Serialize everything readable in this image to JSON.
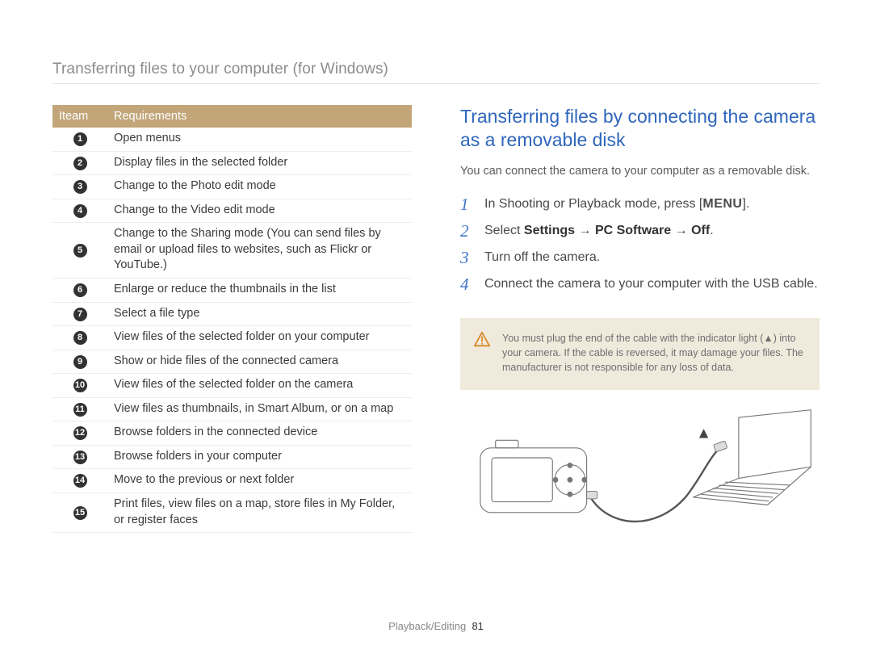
{
  "pageHeader": "Transferring files to your computer (for Windows)",
  "table": {
    "head": [
      "Iteam",
      "Requirements"
    ],
    "rows": [
      "Open menus",
      "Display files in the selected folder",
      "Change to the Photo edit mode",
      "Change to the Video edit mode",
      "Change to the Sharing mode (You can send files by email or upload files to websites, such as Flickr or YouTube.)",
      "Enlarge or reduce the thumbnails in the list",
      "Select a file type",
      "View files of the selected folder on your computer",
      "Show or hide files of the connected camera",
      "View files of the selected folder on the camera",
      "View files as thumbnails, in Smart Album, or on a map",
      "Browse folders in the connected device",
      "Browse folders in your computer",
      "Move to the previous or next folder",
      "Print files, view files on a map, store files in My Folder, or register faces"
    ]
  },
  "right": {
    "title": "Transferring files by connecting the camera as a removable disk",
    "intro": "You can connect the camera to your computer as a removable disk.",
    "steps": {
      "s1_pre": "In Shooting or Playback mode, press [",
      "s1_key": "MENU",
      "s1_post": "].",
      "s2_pre": "Select ",
      "s2_strong1": "Settings",
      "s2_arrow": " → ",
      "s2_strong2": "PC Software",
      "s2_strong3": "Off",
      "s2_post": ".",
      "s3": "Turn off the camera.",
      "s4": "Connect the camera to your computer with the USB cable."
    },
    "notice": "You must plug the end of the cable with the indicator light (▲) into your camera. If the cable is reversed, it may damage your files. The manufacturer is not responsible for any loss of data."
  },
  "footer": {
    "section": "Playback/Editing",
    "page": "81"
  },
  "stepNums": [
    "1",
    "2",
    "3",
    "4"
  ]
}
